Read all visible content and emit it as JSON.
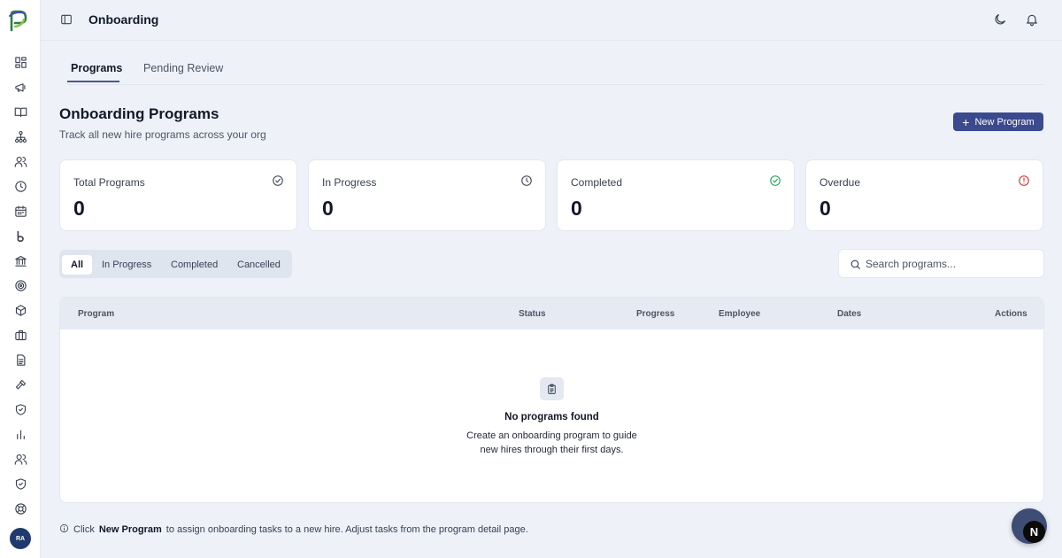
{
  "app": {
    "logo_icon": "brand-logo-icon",
    "user_initials": "RA"
  },
  "sidebar": {
    "items": [
      {
        "icon": "dashboard-icon"
      },
      {
        "icon": "megaphone-icon"
      },
      {
        "icon": "book-icon"
      },
      {
        "icon": "org-chart-icon"
      },
      {
        "icon": "users-icon"
      },
      {
        "icon": "clock-icon"
      },
      {
        "icon": "calendar-icon"
      },
      {
        "icon": "b-brand-icon"
      },
      {
        "icon": "bank-icon"
      },
      {
        "icon": "target-icon"
      },
      {
        "icon": "box-icon"
      },
      {
        "icon": "briefcase-icon"
      },
      {
        "icon": "document-icon"
      },
      {
        "icon": "gavel-icon"
      },
      {
        "icon": "shield-check-icon"
      },
      {
        "icon": "bar-chart-icon"
      },
      {
        "icon": "team-icon"
      },
      {
        "icon": "shield-icon"
      },
      {
        "icon": "lifebuoy-icon"
      }
    ]
  },
  "header": {
    "title": "Onboarding",
    "icons": [
      "sidebar-toggle-icon",
      "moon-icon",
      "bell-icon"
    ]
  },
  "tabs": [
    {
      "label": "Programs",
      "active": true
    },
    {
      "label": "Pending Review",
      "active": false
    }
  ],
  "page": {
    "title": "Onboarding Programs",
    "subtitle": "Track all new hire programs across your org",
    "new_button_label": "New Program"
  },
  "stats": [
    {
      "label": "Total Programs",
      "value": "0",
      "icon": "check-circle-icon",
      "color": "#374151"
    },
    {
      "label": "In Progress",
      "value": "0",
      "icon": "clock-icon",
      "color": "#374151"
    },
    {
      "label": "Completed",
      "value": "0",
      "icon": "check-circle-icon",
      "color": "#16a34a"
    },
    {
      "label": "Overdue",
      "value": "0",
      "icon": "alert-circle-icon",
      "color": "#dc2626"
    }
  ],
  "filters": [
    {
      "label": "All",
      "active": true
    },
    {
      "label": "In Progress",
      "active": false
    },
    {
      "label": "Completed",
      "active": false
    },
    {
      "label": "Cancelled",
      "active": false
    }
  ],
  "search": {
    "placeholder": "Search programs...",
    "value": ""
  },
  "table": {
    "columns": [
      "Program",
      "Status",
      "Progress",
      "Employee",
      "Dates",
      "Actions"
    ],
    "rows": [],
    "empty": {
      "icon": "clipboard-icon",
      "title": "No programs found",
      "description_line1": "Create an onboarding program to guide",
      "description_line2": "new hires through their first days."
    }
  },
  "footer_hint": {
    "prefix": "Click",
    "bold": "New Program",
    "suffix": "to assign onboarding tasks to a new hire. Adjust tasks from the program detail page."
  },
  "fab": {
    "label": "N"
  },
  "colors": {
    "accent": "#3b4a8f",
    "background": "#eef2f8"
  }
}
